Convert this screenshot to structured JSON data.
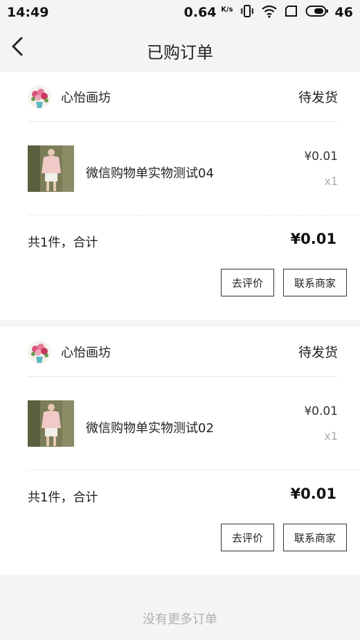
{
  "status_bar": {
    "time": "14:49",
    "speed_value": "0.64",
    "speed_unit": "K/s",
    "signal": "46"
  },
  "nav": {
    "back_icon": "chevron-left-icon",
    "title": "已购订单"
  },
  "orders": [
    {
      "shop_name": "心怡画坊",
      "status": "待发货",
      "item_name": "微信购物单实物测试04",
      "price": "¥0.01",
      "qty": "x1",
      "total_label": "共1件，合计",
      "total_amount": "¥0.01",
      "review_label": "去评价",
      "contact_label": "联系商家"
    },
    {
      "shop_name": "心怡画坊",
      "status": "待发货",
      "item_name": "微信购物单实物测试02",
      "price": "¥0.01",
      "qty": "x1",
      "total_label": "共1件，合计",
      "total_amount": "¥0.01",
      "review_label": "去评价",
      "contact_label": "联系商家"
    }
  ],
  "footer": {
    "no_more": "没有更多订单"
  }
}
